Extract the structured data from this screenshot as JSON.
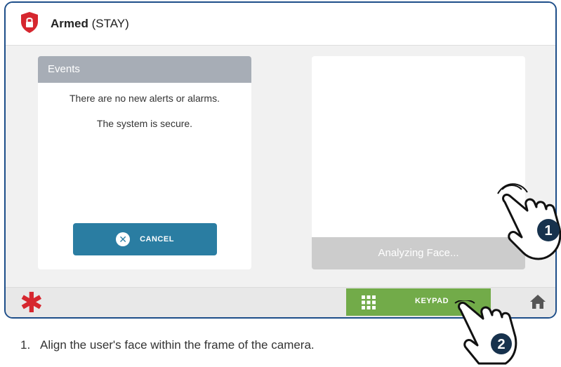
{
  "header": {
    "status_main": "Armed",
    "status_mode": "(STAY)",
    "icon": "lock-shield-icon",
    "accent": "#d6272f"
  },
  "events": {
    "title": "Events",
    "line1": "There are no new alerts or alarms.",
    "line2": "The system is secure.",
    "cancel_label": "CANCEL",
    "cancel_icon": "close-circle-icon",
    "button_color": "#2a7da2"
  },
  "camera": {
    "status": "Analyzing Face..."
  },
  "bottom_bar": {
    "emergency_icon": "asterisk-icon",
    "keypad_label": "KEYPAD",
    "keypad_icon": "keypad-grid-icon",
    "keypad_color": "#72ab49",
    "home_icon": "home-icon"
  },
  "callouts": {
    "first": "1",
    "second": "2"
  },
  "instruction": {
    "number": "1.",
    "text": "Align the user's face within the frame of the camera."
  }
}
